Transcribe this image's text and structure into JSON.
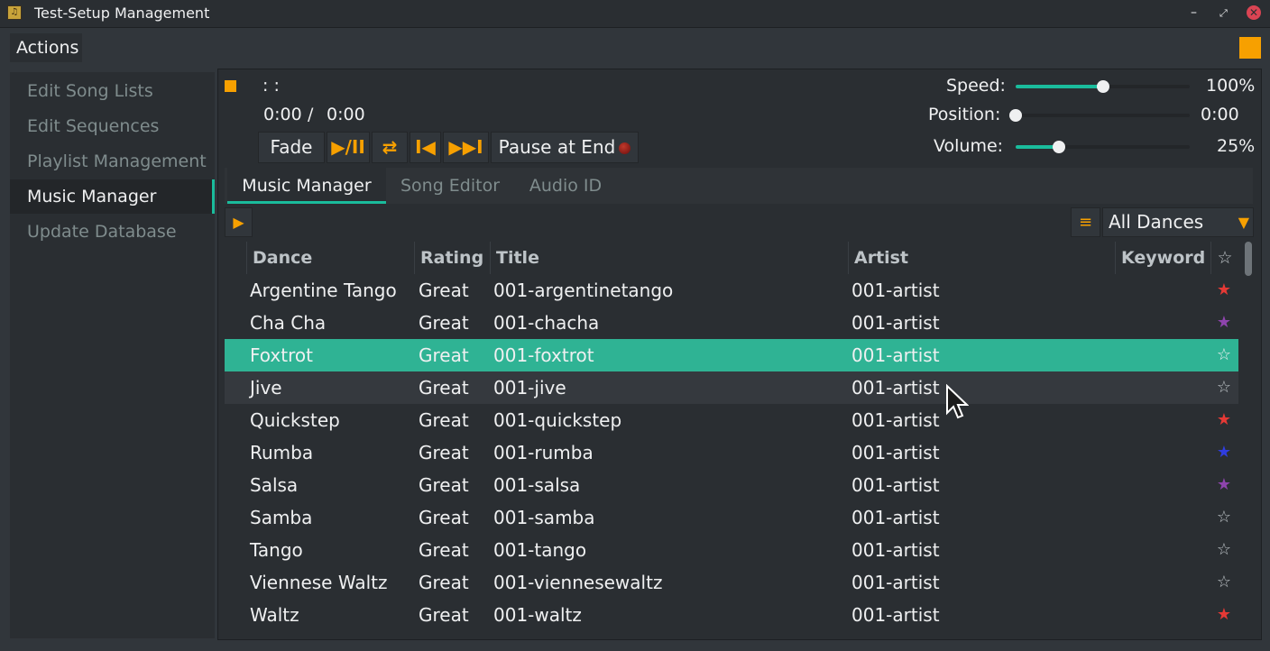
{
  "window": {
    "title": "Test-Setup Management"
  },
  "menu": {
    "actions_label": "Actions"
  },
  "sidebar": {
    "items": [
      {
        "label": "Edit Song Lists"
      },
      {
        "label": "Edit Sequences"
      },
      {
        "label": "Playlist Management"
      },
      {
        "label": "Music Manager",
        "active": true
      },
      {
        "label": "Update Database"
      }
    ]
  },
  "player": {
    "track_info": ": :",
    "elapsed": "0:00",
    "separator": "/",
    "duration": "0:00",
    "fade_label": "Fade",
    "play_pause_glyph": "▶/II",
    "loop_glyph": "⇄",
    "prev_glyph": "I◀",
    "next_glyph": "▶▶I",
    "pause_at_end_label": "Pause at End",
    "speed_label": "Speed:",
    "speed_value": "100%",
    "speed_level": 0.5,
    "position_label": "Position:",
    "position_value": "0:00",
    "position_level": 0.0,
    "volume_label": "Volume:",
    "volume_value": "25%",
    "volume_level": 0.25
  },
  "tabs": [
    {
      "label": "Music Manager",
      "active": true
    },
    {
      "label": "Song Editor"
    },
    {
      "label": "Audio ID"
    }
  ],
  "filter": {
    "dance_selected": "All Dances"
  },
  "table": {
    "columns": [
      "Dance",
      "Rating",
      "Title",
      "Artist",
      "Keyword",
      "☆"
    ],
    "rows": [
      {
        "dance": "Argentine Tango",
        "rating": "Great",
        "title": "001-argentinetango",
        "artist": "001-artist",
        "star": "★",
        "star_color": "#e53935"
      },
      {
        "dance": "Cha Cha",
        "rating": "Great",
        "title": "001-chacha",
        "artist": "001-artist",
        "star": "★",
        "star_color": "#8e44ad"
      },
      {
        "dance": "Foxtrot",
        "rating": "Great",
        "title": "001-foxtrot",
        "artist": "001-artist",
        "star": "☆",
        "star_color": "#eff0f1"
      },
      {
        "dance": "Jive",
        "rating": "Great",
        "title": "001-jive",
        "artist": "001-artist",
        "star": "☆",
        "star_color": "#bdc3c7"
      },
      {
        "dance": "Quickstep",
        "rating": "Great",
        "title": "001-quickstep",
        "artist": "001-artist",
        "star": "★",
        "star_color": "#e53935"
      },
      {
        "dance": "Rumba",
        "rating": "Great",
        "title": "001-rumba",
        "artist": "001-artist",
        "star": "★",
        "star_color": "#2f3de0"
      },
      {
        "dance": "Salsa",
        "rating": "Great",
        "title": "001-salsa",
        "artist": "001-artist",
        "star": "★",
        "star_color": "#8e44ad"
      },
      {
        "dance": "Samba",
        "rating": "Great",
        "title": "001-samba",
        "artist": "001-artist",
        "star": "☆",
        "star_color": "#bdc3c7"
      },
      {
        "dance": "Tango",
        "rating": "Great",
        "title": "001-tango",
        "artist": "001-artist",
        "star": "☆",
        "star_color": "#bdc3c7"
      },
      {
        "dance": "Viennese Waltz",
        "rating": "Great",
        "title": "001-viennesewaltz",
        "artist": "001-artist",
        "star": "☆",
        "star_color": "#bdc3c7"
      },
      {
        "dance": "Waltz",
        "rating": "Great",
        "title": "001-waltz",
        "artist": "001-artist",
        "star": "★",
        "star_color": "#e53935"
      }
    ]
  },
  "colors": {
    "accent": "#1abc9c",
    "orange": "#f7a000",
    "selected_row": "#2fb394"
  }
}
